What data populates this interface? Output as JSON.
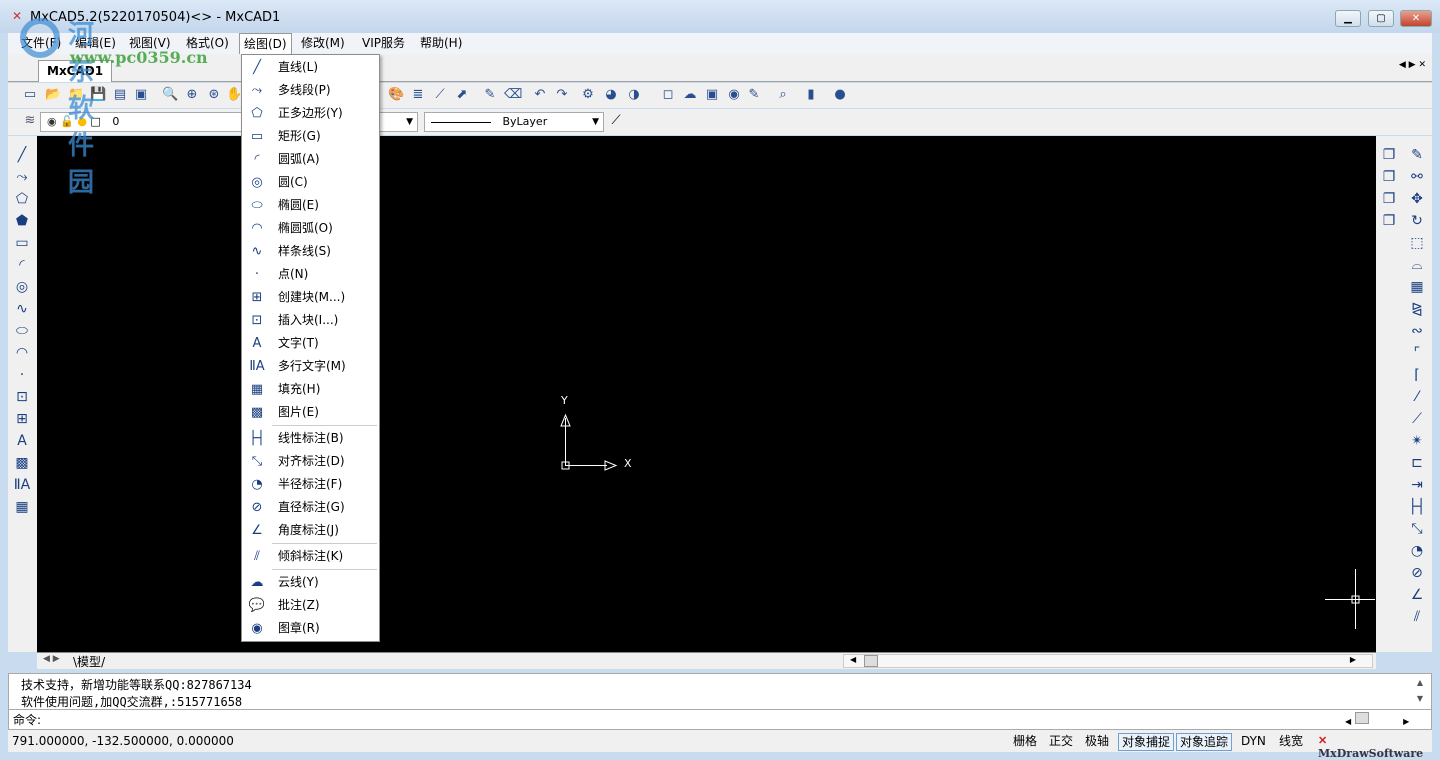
{
  "window": {
    "title": "MxCAD5.2(5220170504)<> - MxCAD1",
    "controls": [
      "minimize",
      "maximize",
      "close"
    ]
  },
  "watermark": {
    "line1": "河东软件园",
    "line2": "www.pc0359.cn"
  },
  "menubar": [
    {
      "label": "文件(F)"
    },
    {
      "label": "编辑(E)"
    },
    {
      "label": "视图(V)"
    },
    {
      "label": "格式(O)"
    },
    {
      "label": "绘图(D)",
      "active": true
    },
    {
      "label": "修改(M)"
    },
    {
      "label": "VIP服务"
    },
    {
      "label": "帮助(H)"
    }
  ],
  "document_tab": "MxCAD1",
  "layer": {
    "name": "0",
    "linetype": "ByLayer"
  },
  "draw_menu": [
    {
      "icon": "line-icon",
      "g": "╱",
      "label": "直线(L)"
    },
    {
      "icon": "polyline-icon",
      "g": "⤳",
      "label": "多线段(P)"
    },
    {
      "icon": "polygon-icon",
      "g": "⬠",
      "label": "正多边形(Y)"
    },
    {
      "icon": "rectangle-icon",
      "g": "▭",
      "label": "矩形(G)"
    },
    {
      "icon": "arc-icon",
      "g": "◜",
      "label": "圆弧(A)"
    },
    {
      "icon": "circle-icon",
      "g": "◎",
      "label": "圆(C)"
    },
    {
      "icon": "ellipse-icon",
      "g": "⬭",
      "label": "椭圆(E)"
    },
    {
      "icon": "elliptical-arc-icon",
      "g": "◠",
      "label": "椭圆弧(O)"
    },
    {
      "icon": "spline-icon",
      "g": "∿",
      "label": "样条线(S)"
    },
    {
      "icon": "point-icon",
      "g": "·",
      "label": "点(N)"
    },
    {
      "icon": "create-block-icon",
      "g": "⊞",
      "label": "创建块(M...)"
    },
    {
      "icon": "insert-block-icon",
      "g": "⊡",
      "label": "插入块(I...)"
    },
    {
      "icon": "text-icon",
      "g": "A",
      "label": "文字(T)"
    },
    {
      "icon": "mtext-icon",
      "g": "ⅡA",
      "label": "多行文字(M)"
    },
    {
      "icon": "hatch-icon",
      "g": "▦",
      "label": "填充(H)"
    },
    {
      "icon": "image-icon",
      "g": "▩",
      "label": "图片(E)"
    },
    {
      "icon": "linear-dim-icon",
      "g": "├┤",
      "label": "线性标注(B)",
      "sep": true
    },
    {
      "icon": "aligned-dim-icon",
      "g": "⤡",
      "label": "对齐标注(D)"
    },
    {
      "icon": "radius-dim-icon",
      "g": "◔",
      "label": "半径标注(F)"
    },
    {
      "icon": "diameter-dim-icon",
      "g": "⊘",
      "label": "直径标注(G)"
    },
    {
      "icon": "angle-dim-icon",
      "g": "∠",
      "label": "角度标注(J)"
    },
    {
      "icon": "oblique-dim-icon",
      "g": "⫽",
      "label": "倾斜标注(K)",
      "sep": true
    },
    {
      "icon": "revcloud-icon",
      "g": "☁",
      "label": "云线(Y)",
      "sep": true
    },
    {
      "icon": "annotation-icon",
      "g": "💬",
      "label": "批注(Z)"
    },
    {
      "icon": "stamp-icon",
      "g": "◉",
      "label": "图章(R)"
    }
  ],
  "canvas": {
    "ucs_x": "X",
    "ucs_y": "Y"
  },
  "model_tab": "模型",
  "command": {
    "lines": [
      "技术支持，新增功能等联系QQ:827867134",
      "软件使用问题,加QQ交流群,:515771658"
    ],
    "prompt": "命令:"
  },
  "status": {
    "coords": "791.000000,  -132.500000,  0.000000",
    "toggles": [
      {
        "label": "栅格",
        "on": false
      },
      {
        "label": "正交",
        "on": false
      },
      {
        "label": "极轴",
        "on": false
      },
      {
        "label": "对象捕捉",
        "on": true
      },
      {
        "label": "对象追踪",
        "on": true
      },
      {
        "label": "DYN",
        "on": false
      },
      {
        "label": "线宽",
        "on": false
      }
    ],
    "brand": "MxDrawSoftware"
  }
}
